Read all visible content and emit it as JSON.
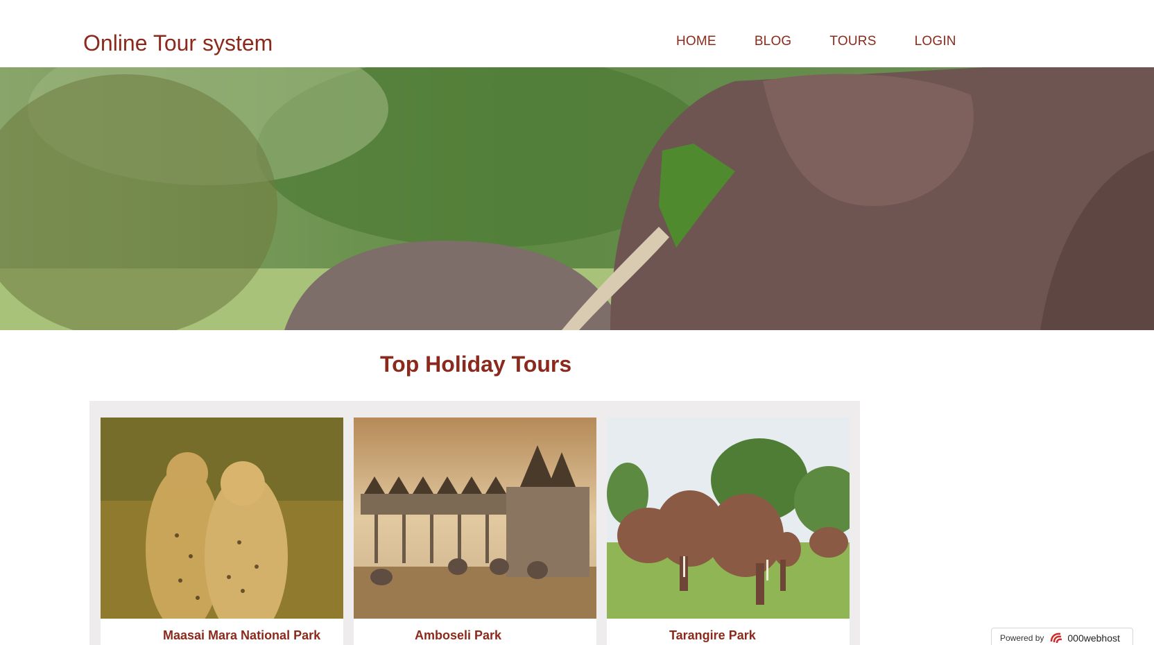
{
  "header": {
    "brand": "Online Tour system",
    "nav": [
      {
        "label": "HOME"
      },
      {
        "label": "BLOG"
      },
      {
        "label": "TOURS"
      },
      {
        "label": "LOGIN"
      }
    ]
  },
  "main": {
    "section_title": "Top Holiday Tours",
    "tours": [
      {
        "name": "Maasai Mara National Park",
        "photo_icon": "cheetah-photo"
      },
      {
        "name": "Amboseli Park",
        "photo_icon": "lodge-elephants-photo"
      },
      {
        "name": "Tarangire Park",
        "photo_icon": "elephant-herd-photo"
      }
    ]
  },
  "badge": {
    "powered_by": "Powered by",
    "provider": "000webhost"
  },
  "colors": {
    "accent": "#8b2a1c",
    "panel": "#eeecec"
  }
}
